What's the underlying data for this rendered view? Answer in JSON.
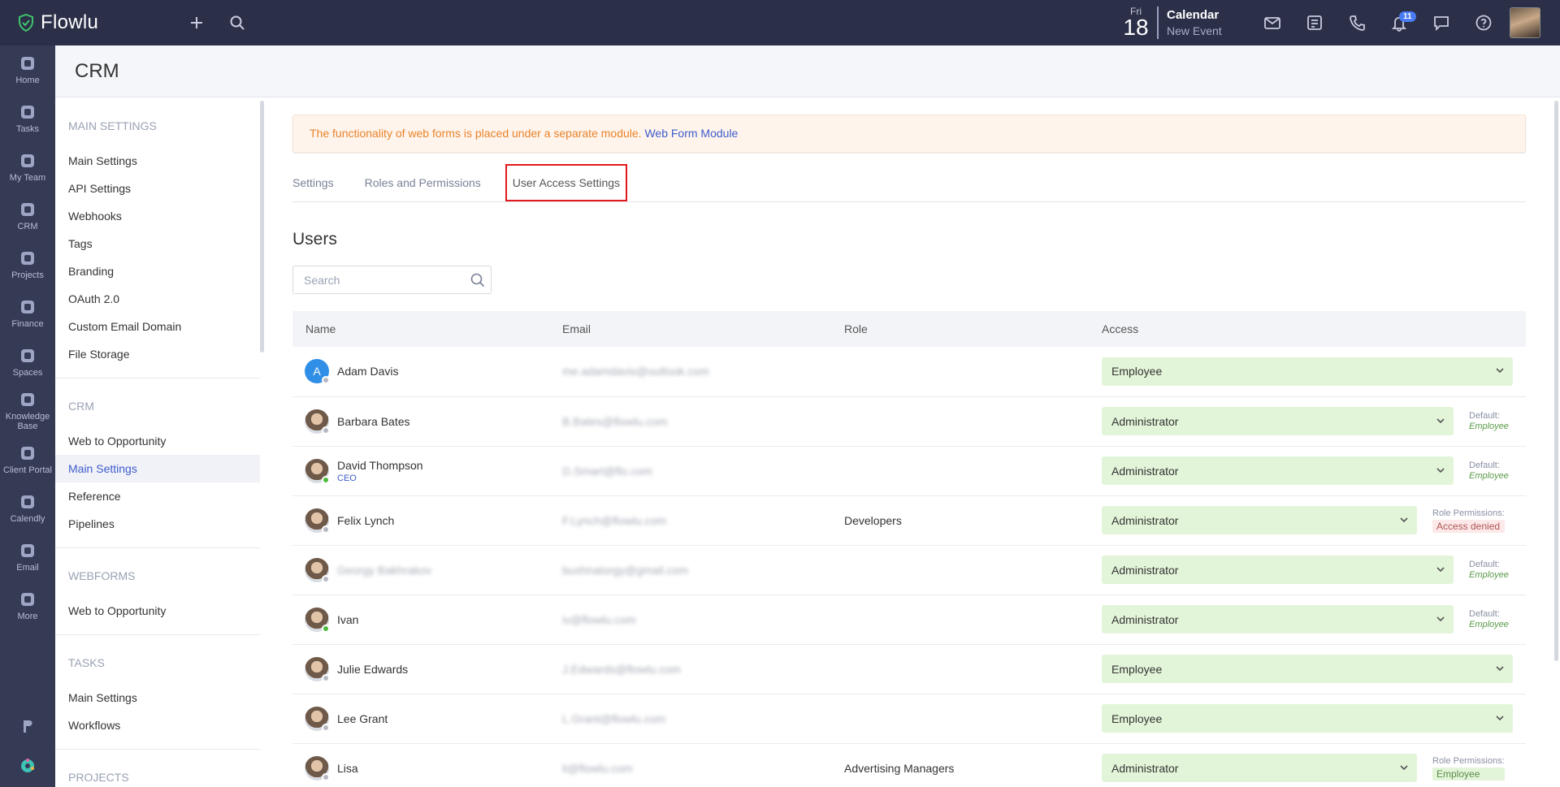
{
  "app": {
    "name": "Flowlu"
  },
  "calendar": {
    "day": "Fri",
    "date": "18",
    "title": "Calendar",
    "subtitle": "New Event"
  },
  "notifications": {
    "count": "11"
  },
  "rail": [
    {
      "label": "Home",
      "icon": "home-icon"
    },
    {
      "label": "Tasks",
      "icon": "tasks-icon"
    },
    {
      "label": "My Team",
      "icon": "team-icon"
    },
    {
      "label": "CRM",
      "icon": "crm-icon"
    },
    {
      "label": "Projects",
      "icon": "projects-icon"
    },
    {
      "label": "Finance",
      "icon": "finance-icon"
    },
    {
      "label": "Spaces",
      "icon": "spaces-icon"
    },
    {
      "label": "Knowledge Base",
      "icon": "knowledge-base-icon"
    },
    {
      "label": "Client Portal",
      "icon": "client-portal-icon"
    },
    {
      "label": "Calendly",
      "icon": "calendly-icon"
    },
    {
      "label": "Email",
      "icon": "email-icon"
    },
    {
      "label": "More",
      "icon": "more-icon"
    }
  ],
  "page": {
    "title": "CRM"
  },
  "nav": {
    "sections": [
      {
        "heading": "MAIN SETTINGS",
        "items": [
          "Main Settings",
          "API Settings",
          "Webhooks",
          "Tags",
          "Branding",
          "OAuth 2.0",
          "Custom Email Domain",
          "File Storage"
        ]
      },
      {
        "heading": "CRM",
        "items": [
          "Web to Opportunity",
          "Main Settings",
          "Reference",
          "Pipelines"
        ]
      },
      {
        "heading": "WEBFORMS",
        "items": [
          "Web to Opportunity"
        ]
      },
      {
        "heading": "TASKS",
        "items": [
          "Main Settings",
          "Workflows"
        ]
      },
      {
        "heading": "PROJECTS",
        "items": []
      }
    ]
  },
  "alert": {
    "text": "The functionality of web forms is placed under a separate module.",
    "link": "Web Form Module"
  },
  "tabs": [
    "Settings",
    "Roles and Permissions",
    "User Access Settings"
  ],
  "users": {
    "title": "Users",
    "search_placeholder": "Search",
    "columns": [
      "Name",
      "Email",
      "Role",
      "Access"
    ],
    "rows": [
      {
        "name": "Adam Davis",
        "sub": "",
        "email": "me.adamdavis@outlook.com",
        "role": "",
        "access": "Employee",
        "note_label": "",
        "note_value": "",
        "note_style": ""
      },
      {
        "name": "Barbara Bates",
        "sub": "",
        "email": "B.Bates@flowlu.com",
        "role": "",
        "access": "Administrator",
        "note_label": "Default:",
        "note_value": "Employee",
        "note_style": "italic"
      },
      {
        "name": "David Thompson",
        "sub": "CEO",
        "email": "D.Smart@flo.com",
        "role": "",
        "access": "Administrator",
        "note_label": "Default:",
        "note_value": "Employee",
        "note_style": "italic"
      },
      {
        "name": "Felix Lynch",
        "sub": "",
        "email": "F.Lynch@flowlu.com",
        "role": "Developers",
        "access": "Administrator",
        "note_label": "Role Permissions:",
        "note_value": "Access denied",
        "note_style": "denied"
      },
      {
        "name": "Georgy Bakhrakov",
        "sub": "",
        "email": "bushnatorgy@gmail.com",
        "role": "",
        "access": "Administrator",
        "note_label": "Default:",
        "note_value": "Employee",
        "note_style": "italic"
      },
      {
        "name": "Ivan",
        "sub": "",
        "email": "iv@flowlu.com",
        "role": "",
        "access": "Administrator",
        "note_label": "Default:",
        "note_value": "Employee",
        "note_style": "italic"
      },
      {
        "name": "Julie Edwards",
        "sub": "",
        "email": "J.Edwards@flowlu.com",
        "role": "",
        "access": "Employee",
        "note_label": "",
        "note_value": "",
        "note_style": ""
      },
      {
        "name": "Lee Grant",
        "sub": "",
        "email": "L.Grant@flowlu.com",
        "role": "",
        "access": "Employee",
        "note_label": "",
        "note_value": "",
        "note_style": ""
      },
      {
        "name": "Lisa",
        "sub": "",
        "email": "li@flowlu.com",
        "role": "Advertising Managers",
        "access": "Administrator",
        "note_label": "Role Permissions:",
        "note_value": "Employee",
        "note_style": "ok"
      }
    ]
  },
  "colors": {
    "topbar": "#2b2f48",
    "rail": "#353a55",
    "accent": "#3d5ccc",
    "alert_text": "#e8832a",
    "access_bg": "#e3f5d9",
    "tab_highlight": "#e2191b"
  }
}
